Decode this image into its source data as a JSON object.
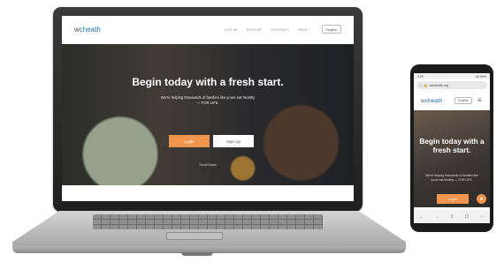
{
  "laptop": {
    "logo": {
      "pre": "w",
      "brand": "cheath"
    },
    "nav": [
      "LOG IN",
      "SIGN UP",
      "CONTACT",
      "HELP"
    ],
    "language": "English",
    "hero": {
      "title": "Begin today with a fresh start.",
      "subtitle": "We're helping thousands of families like yours eat healthy — FOR LIFE.",
      "login": "Login",
      "signup": "Sign Up",
      "footer": "Scroll Down"
    }
  },
  "phone": {
    "status_left": "2:29",
    "status_right": "4G 90%",
    "url": "wecheath.org",
    "logo": {
      "pre": "w",
      "brand": "cheath"
    },
    "language": "English",
    "menu_icon": "hamburger-icon",
    "hero": {
      "title": "Begin today with a fresh start.",
      "subtitle": "We're helping thousands of families like yours eat healthy — FOR LIFE.",
      "login": "Login"
    },
    "bottom_icons": [
      "back-icon",
      "forward-icon",
      "share-icon",
      "bookmark-icon",
      "tabs-icon"
    ]
  }
}
